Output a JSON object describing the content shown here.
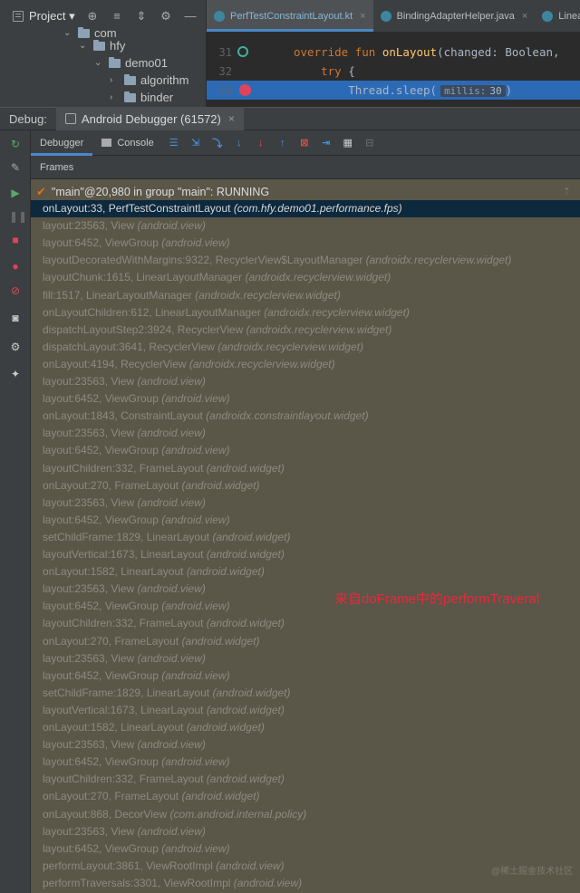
{
  "project": {
    "title": "Project ▾"
  },
  "tree": [
    {
      "label": "com",
      "indent": 0
    },
    {
      "label": "hfy",
      "indent": 1
    },
    {
      "label": "demo01",
      "indent": 2
    },
    {
      "label": "algorithm",
      "indent": 3
    },
    {
      "label": "binder",
      "indent": 3
    }
  ],
  "tabs": [
    {
      "label": "PerfTestConstraintLayout.kt",
      "active": true
    },
    {
      "label": "BindingAdapterHelper.java",
      "active": false
    },
    {
      "label": "Linea",
      "active": false
    }
  ],
  "editor": {
    "lines": [
      {
        "num": "31",
        "kw": "override fun ",
        "fn": "onLayout",
        "rest": "(changed: Boolean,"
      },
      {
        "num": "32",
        "kw": "try ",
        "rest": "{"
      },
      {
        "num": "33",
        "pre": "Thread.sleep(",
        "hint_name": "millis:",
        "hint_val": "30",
        "post": ")"
      }
    ]
  },
  "debug": {
    "label": "Debug:",
    "tab": "Android Debugger (61572)"
  },
  "toolbar": {
    "debugger": "Debugger",
    "console": "Console"
  },
  "frames_header": "Frames",
  "thread": "\"main\"@20,980 in group \"main\": RUNNING",
  "frames": [
    {
      "m": "onLayout:33, PerfTestConstraintLayout",
      "p": "(com.hfy.demo01.performance.fps)",
      "sel": true
    },
    {
      "m": "layout:23563, View",
      "p": "(android.view)"
    },
    {
      "m": "layout:6452, ViewGroup",
      "p": "(android.view)"
    },
    {
      "m": "layoutDecoratedWithMargins:9322, RecyclerView$LayoutManager",
      "p": "(androidx.recyclerview.widget)"
    },
    {
      "m": "layoutChunk:1615, LinearLayoutManager",
      "p": "(androidx.recyclerview.widget)"
    },
    {
      "m": "fill:1517, LinearLayoutManager",
      "p": "(androidx.recyclerview.widget)"
    },
    {
      "m": "onLayoutChildren:612, LinearLayoutManager",
      "p": "(androidx.recyclerview.widget)"
    },
    {
      "m": "dispatchLayoutStep2:3924, RecyclerView",
      "p": "(androidx.recyclerview.widget)"
    },
    {
      "m": "dispatchLayout:3641, RecyclerView",
      "p": "(androidx.recyclerview.widget)"
    },
    {
      "m": "onLayout:4194, RecyclerView",
      "p": "(androidx.recyclerview.widget)"
    },
    {
      "m": "layout:23563, View",
      "p": "(android.view)"
    },
    {
      "m": "layout:6452, ViewGroup",
      "p": "(android.view)"
    },
    {
      "m": "onLayout:1843, ConstraintLayout",
      "p": "(androidx.constraintlayout.widget)"
    },
    {
      "m": "layout:23563, View",
      "p": "(android.view)"
    },
    {
      "m": "layout:6452, ViewGroup",
      "p": "(android.view)"
    },
    {
      "m": "layoutChildren:332, FrameLayout",
      "p": "(android.widget)"
    },
    {
      "m": "onLayout:270, FrameLayout",
      "p": "(android.widget)"
    },
    {
      "m": "layout:23563, View",
      "p": "(android.view)"
    },
    {
      "m": "layout:6452, ViewGroup",
      "p": "(android.view)"
    },
    {
      "m": "setChildFrame:1829, LinearLayout",
      "p": "(android.widget)"
    },
    {
      "m": "layoutVertical:1673, LinearLayout",
      "p": "(android.widget)"
    },
    {
      "m": "onLayout:1582, LinearLayout",
      "p": "(android.widget)"
    },
    {
      "m": "layout:23563, View",
      "p": "(android.view)"
    },
    {
      "m": "layout:6452, ViewGroup",
      "p": "(android.view)"
    },
    {
      "m": "layoutChildren:332, FrameLayout",
      "p": "(android.widget)"
    },
    {
      "m": "onLayout:270, FrameLayout",
      "p": "(android.widget)"
    },
    {
      "m": "layout:23563, View",
      "p": "(android.view)"
    },
    {
      "m": "layout:6452, ViewGroup",
      "p": "(android.view)"
    },
    {
      "m": "setChildFrame:1829, LinearLayout",
      "p": "(android.widget)"
    },
    {
      "m": "layoutVertical:1673, LinearLayout",
      "p": "(android.widget)"
    },
    {
      "m": "onLayout:1582, LinearLayout",
      "p": "(android.widget)"
    },
    {
      "m": "layout:23563, View",
      "p": "(android.view)"
    },
    {
      "m": "layout:6452, ViewGroup",
      "p": "(android.view)"
    },
    {
      "m": "layoutChildren:332, FrameLayout",
      "p": "(android.widget)"
    },
    {
      "m": "onLayout:270, FrameLayout",
      "p": "(android.widget)"
    },
    {
      "m": "onLayout:868, DecorView",
      "p": "(com.android.internal.policy)"
    },
    {
      "m": "layout:23563, View",
      "p": "(android.view)"
    },
    {
      "m": "layout:6452, ViewGroup",
      "p": "(android.view)"
    },
    {
      "m": "performLayout:3861, ViewRootImpl",
      "p": "(android.view)"
    },
    {
      "m": "performTraversals:3301, ViewRootImpl",
      "p": "(android.view)"
    }
  ],
  "annotation": "来自doFrame中的performTraveral",
  "watermark": "@稀土掘金技术社区",
  "colors": {
    "selection": "#0d293e",
    "annotation": "#e8283c",
    "list_bg": "#5a5648"
  }
}
